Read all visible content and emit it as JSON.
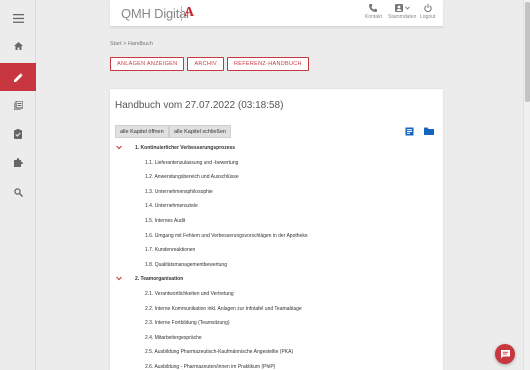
{
  "brand": {
    "logo_text": "QMH Digital",
    "logo_mark": "A",
    "accent": "#c8373f"
  },
  "sidebar": {
    "items": [
      {
        "icon": "menu-icon"
      },
      {
        "icon": "home-icon"
      },
      {
        "icon": "pencil-icon",
        "active": true
      },
      {
        "icon": "library-icon"
      },
      {
        "icon": "clipboard-check-icon"
      },
      {
        "icon": "puzzle-icon"
      },
      {
        "icon": "search-icon"
      }
    ]
  },
  "header": {
    "actions": [
      {
        "label": "Kontakt",
        "icon": "phone-icon"
      },
      {
        "label": "Stammdaten",
        "icon": "account-box-icon"
      },
      {
        "label": "Logout",
        "icon": "power-icon"
      }
    ]
  },
  "breadcrumb": {
    "home": "Start",
    "separator": ">",
    "current": "Handbuch"
  },
  "toolbar": {
    "attachments_label": "ANLAGEN ANZEIGEN",
    "archive_label": "ARCHIV",
    "reference_label": "REFERENZ-HANDBUCH"
  },
  "handbook": {
    "title": "Handbuch vom 27.07.2022 (03:18:58)",
    "open_all_label": "alle Kapitel öffnen",
    "close_all_label": "alle Kapitel schließen",
    "chapters": [
      {
        "title": "1. Kontinuierlicher Verbesserungsprozess",
        "sections": [
          "1.1. Lieferantenzulassung und -bewertung",
          "1.2. Anwendungsbereich und Ausschlüsse",
          "1.3. Unternehmensphilosophie",
          "1.4. Unternehmensziele",
          "1.5. Internes Audit",
          "1.6. Umgang mit Fehlern und Verbesserungsvorschlägen in der Apotheke",
          "1.7. Kundenreaktionen",
          "1.8. Qualitätsmanagementbewertung"
        ]
      },
      {
        "title": "2. Teamorganisation",
        "sections": [
          "2.1. Verantwortlichkeiten und Vertretung",
          "2.2. Interne Kommunikation inkl. Anlagen zur Infotafel und Teamablage",
          "2.3. Interne Fortbildung (Teamsitzung)",
          "2.4. Mitarbeitergespräche",
          "2.5. Ausbildung Pharmazeutisch-Kaufmännische Angestellte (PKA)",
          "2.6. Ausbildung - Pharmazeuten/innen im Praktikum (PhiP)"
        ]
      }
    ]
  }
}
